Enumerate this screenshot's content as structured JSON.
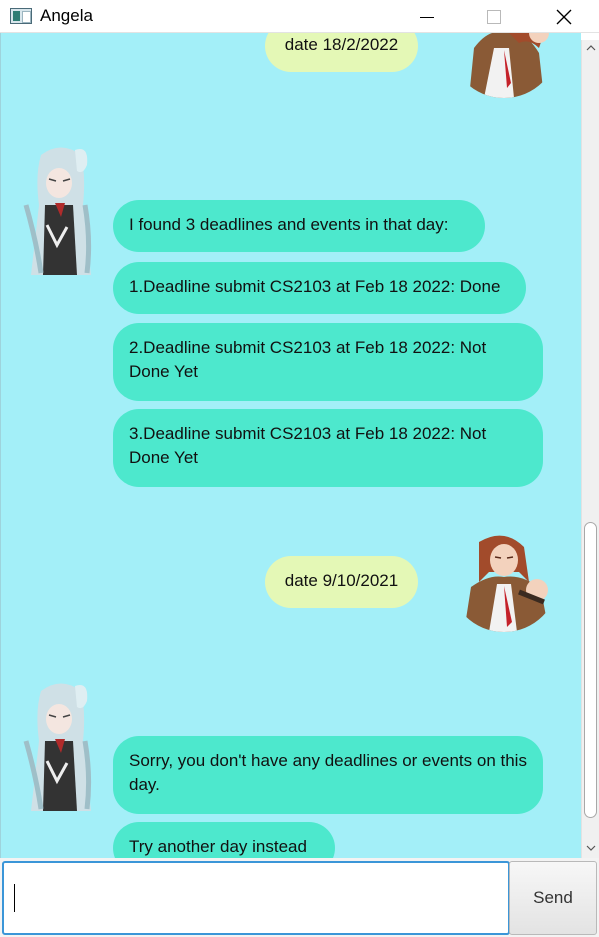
{
  "window": {
    "title": "Angela",
    "icon": "app-window-icon",
    "controls": {
      "minimize_icon": "minimize-icon",
      "maximize_icon": "maximize-icon",
      "close_glyph": "✕"
    }
  },
  "chat": {
    "background": "#a3eff8",
    "user_bubble_color": "#e4f8b6",
    "bot_bubble_color": "#4de8cd",
    "messages": [
      {
        "sender": "user",
        "text": "date 18/2/2022"
      },
      {
        "sender": "bot",
        "text": " I found 3 deadlines and events in that day:"
      },
      {
        "sender": "bot",
        "text": "1.Deadline submit CS2103 at Feb 18 2022: Done"
      },
      {
        "sender": "bot",
        "text": "2.Deadline submit CS2103 at Feb 18 2022: Not Done Yet"
      },
      {
        "sender": "bot",
        "text": "3.Deadline submit CS2103 at Feb 18 2022: Not Done Yet"
      },
      {
        "sender": "user",
        "text": "date 9/10/2021"
      },
      {
        "sender": "bot",
        "text": " Sorry, you don't have any deadlines or events on this day."
      },
      {
        "sender": "bot",
        "text": " Try another day instead"
      }
    ]
  },
  "input": {
    "value": "",
    "placeholder": ""
  },
  "send_button": {
    "label": "Send"
  },
  "accent_color": "#3b96d8"
}
